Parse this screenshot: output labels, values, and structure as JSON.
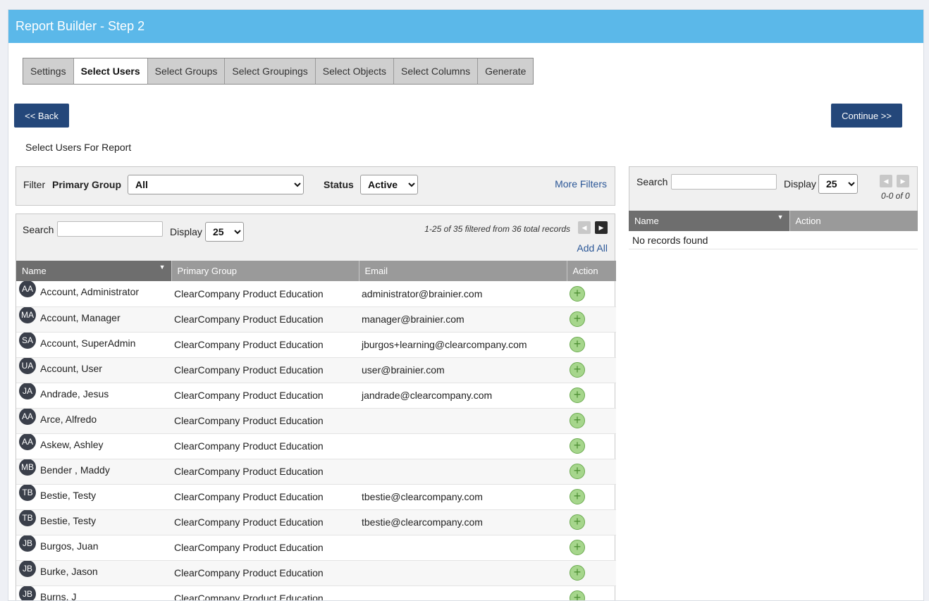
{
  "header": {
    "title": "Report Builder - Step 2"
  },
  "tabs": [
    {
      "label": "Settings",
      "active": false
    },
    {
      "label": "Select Users",
      "active": true
    },
    {
      "label": "Select Groups",
      "active": false
    },
    {
      "label": "Select Groupings",
      "active": false
    },
    {
      "label": "Select Objects",
      "active": false
    },
    {
      "label": "Select Columns",
      "active": false
    },
    {
      "label": "Generate",
      "active": false
    }
  ],
  "nav": {
    "back_label": "<< Back",
    "continue_label": "Continue >>"
  },
  "section_label": "Select Users For Report",
  "filter": {
    "label": "Filter",
    "primary_group_label": "Primary Group",
    "primary_group_value": "All",
    "status_label": "Status",
    "status_value": "Active",
    "more_filters": "More Filters"
  },
  "users_list": {
    "search_label": "Search",
    "search_value": "",
    "display_label": "Display",
    "display_value": "25",
    "records_info": "1-25 of 35 filtered from 36 total records",
    "prev_icon": "◀",
    "next_icon": "▶",
    "add_all": "Add All",
    "sort_icon": "▼",
    "add_icon": "+",
    "columns": [
      "Name",
      "Primary Group",
      "Email",
      "Action"
    ],
    "rows": [
      {
        "initials": "AA",
        "name": "Account, Administrator",
        "group": "ClearCompany Product Education",
        "email": "administrator@brainier.com"
      },
      {
        "initials": "MA",
        "name": "Account, Manager",
        "group": "ClearCompany Product Education",
        "email": "manager@brainier.com"
      },
      {
        "initials": "SA",
        "name": "Account, SuperAdmin",
        "group": "ClearCompany Product Education",
        "email": "jburgos+learning@clearcompany.com"
      },
      {
        "initials": "UA",
        "name": "Account, User",
        "group": "ClearCompany Product Education",
        "email": "user@brainier.com"
      },
      {
        "initials": "JA",
        "name": "Andrade, Jesus",
        "group": "ClearCompany Product Education",
        "email": "jandrade@clearcompany.com"
      },
      {
        "initials": "AA",
        "name": "Arce, Alfredo",
        "group": "ClearCompany Product Education",
        "email": ""
      },
      {
        "initials": "AA",
        "name": "Askew, Ashley",
        "group": "ClearCompany Product Education",
        "email": ""
      },
      {
        "initials": "MB",
        "name": "Bender , Maddy",
        "group": "ClearCompany Product Education",
        "email": ""
      },
      {
        "initials": "TB",
        "name": "Bestie, Testy",
        "group": "ClearCompany Product Education",
        "email": "tbestie@clearcompany.com"
      },
      {
        "initials": "TB",
        "name": "Bestie, Testy",
        "group": "ClearCompany Product Education",
        "email": "tbestie@clearcompany.com"
      },
      {
        "initials": "JB",
        "name": "Burgos, Juan",
        "group": "ClearCompany Product Education",
        "email": ""
      },
      {
        "initials": "JB",
        "name": "Burke, Jason",
        "group": "ClearCompany Product Education",
        "email": ""
      },
      {
        "initials": "JB",
        "name": "Burns, J",
        "group": "ClearCompany Product Education",
        "email": ""
      }
    ]
  },
  "selected_list": {
    "search_label": "Search",
    "search_value": "",
    "display_label": "Display",
    "display_value": "25",
    "records_info": "0-0 of 0",
    "prev_icon": "◀",
    "next_icon": "▶",
    "sort_icon": "▼",
    "columns": [
      "Name",
      "Action"
    ],
    "empty_text": "No records found"
  },
  "colors": {
    "header": "#5bb8e9",
    "button": "#24477a",
    "link": "#2b5797",
    "add_icon": "#a6d68c"
  }
}
